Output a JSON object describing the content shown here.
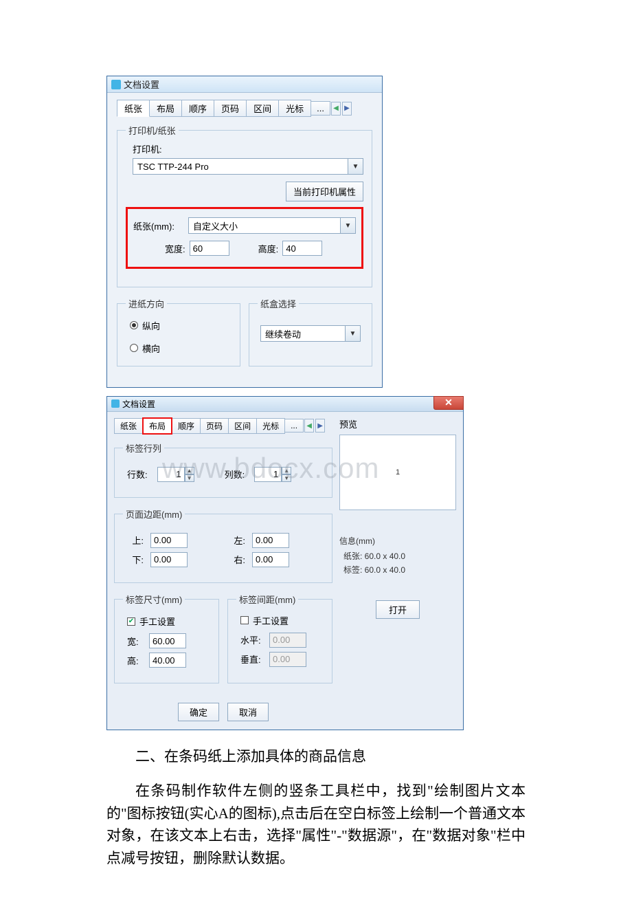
{
  "dlg1": {
    "title": "文档设置",
    "tabs": [
      "纸张",
      "布局",
      "顺序",
      "页码",
      "区间",
      "光标"
    ],
    "tab_ellipsis": "...",
    "printer": {
      "legend": "打印机/纸张",
      "printer_label": "打印机:",
      "printer_value": "TSC TTP-244 Pro",
      "props_btn": "当前打印机属性",
      "paper_label": "纸张(mm):",
      "paper_value": "自定义大小",
      "width_label": "宽度:",
      "width_value": "60",
      "height_label": "高度:",
      "height_value": "40"
    },
    "feed": {
      "legend": "进纸方向",
      "portrait": "纵向",
      "landscape": "横向"
    },
    "tray": {
      "legend": "纸盒选择",
      "value": "继续卷动"
    }
  },
  "dlg2": {
    "title": "文档设置",
    "tabs": [
      "纸张",
      "布局",
      "顺序",
      "页码",
      "区间",
      "光标"
    ],
    "tab_ellipsis": "...",
    "rowscols": {
      "legend": "标签行列",
      "rows_label": "行数:",
      "rows_value": "1",
      "cols_label": "列数:",
      "cols_value": "1"
    },
    "margins": {
      "legend": "页面边距(mm)",
      "top_label": "上:",
      "top_value": "0.00",
      "bottom_label": "下:",
      "bottom_value": "0.00",
      "left_label": "左:",
      "left_value": "0.00",
      "right_label": "右:",
      "right_value": "0.00"
    },
    "labelsize": {
      "legend": "标签尺寸(mm)",
      "manual": "手工设置",
      "w_label": "宽:",
      "w_value": "60.00",
      "h_label": "高:",
      "h_value": "40.00"
    },
    "gap": {
      "legend": "标签间距(mm)",
      "manual": "手工设置",
      "h_label": "水平:",
      "h_value": "0.00",
      "v_label": "垂直:",
      "v_value": "0.00"
    },
    "preview_label": "预览",
    "preview_text": "1",
    "info": {
      "legend": "信息(mm)",
      "paper": "纸张: 60.0 x 40.0",
      "label": "标签: 60.0 x 40.0"
    },
    "ok": "确定",
    "cancel": "取消",
    "open": "打开"
  },
  "watermark": "www.bdocx.com",
  "body": {
    "heading": "二、在条码纸上添加具体的商品信息",
    "para": "在条码制作软件左侧的竖条工具栏中，找到\"绘制图片文本的\"图标按钮(实心A的图标),点击后在空白标签上绘制一个普通文本对象，在该文本上右击，选择\"属性\"-\"数据源\"，在\"数据对象\"栏中点减号按钮，删除默认数据。"
  }
}
